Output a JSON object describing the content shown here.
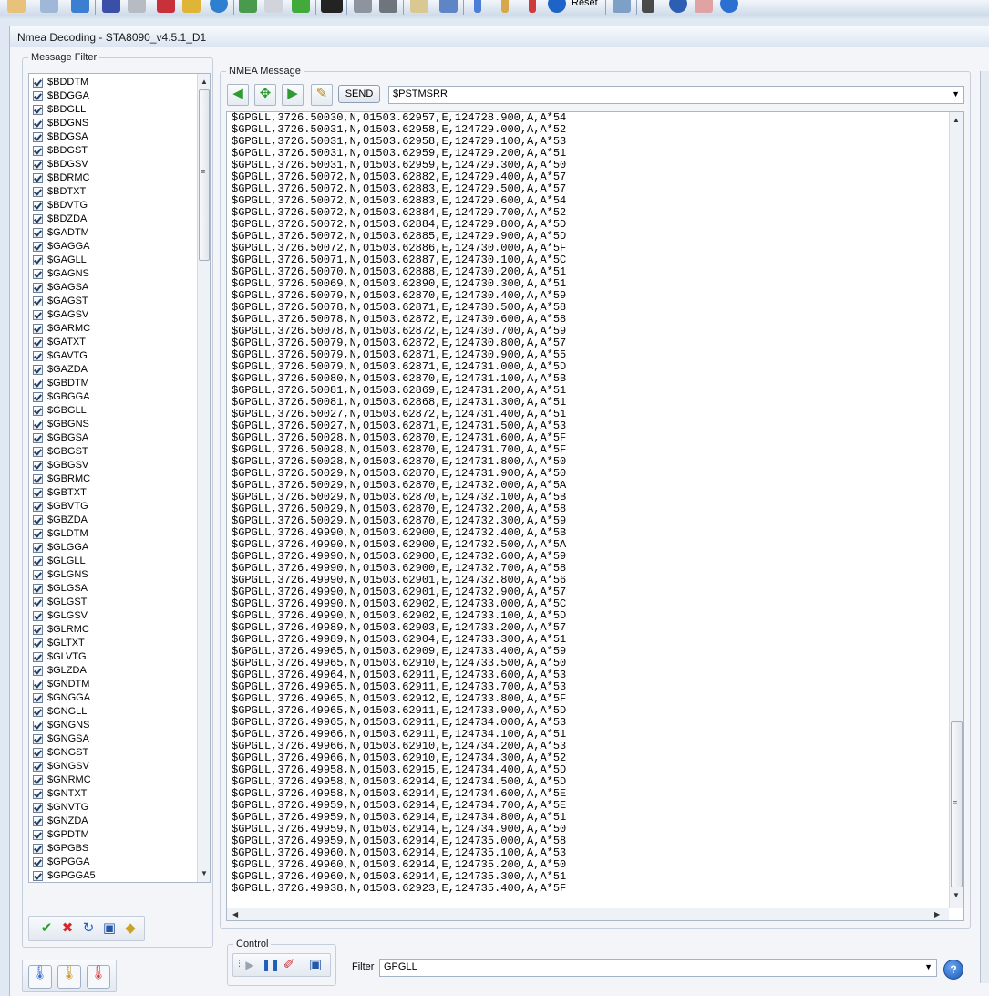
{
  "toolbar": {
    "reset_label": "Reset",
    "icons": [
      "edit-icon",
      "magnifier-icon",
      "settings-icon",
      "satellite-n-icon",
      "gear-icon",
      "antenna-icon",
      "chart-icon",
      "globe-icon",
      "signal-icon",
      "mouse-icon",
      "play-icon",
      "terminal-icon",
      "database-icon",
      "trash-icon",
      "map-icon",
      "document-icon",
      "thermometer-cold-icon",
      "thermometer-mid-icon",
      "thermometer-hot-icon",
      "reset-icon",
      "shield-icon",
      "tower-icon",
      "wave-icon",
      "graph-icon",
      "info-icon"
    ]
  },
  "window": {
    "title": "Nmea Decoding - STA8090_v4.5.1_D1"
  },
  "message_filter": {
    "legend": "Message Filter",
    "items": [
      "$BDDTM",
      "$BDGGA",
      "$BDGLL",
      "$BDGNS",
      "$BDGSA",
      "$BDGST",
      "$BDGSV",
      "$BDRMC",
      "$BDTXT",
      "$BDVTG",
      "$BDZDA",
      "$GADTM",
      "$GAGGA",
      "$GAGLL",
      "$GAGNS",
      "$GAGSA",
      "$GAGST",
      "$GAGSV",
      "$GARMC",
      "$GATXT",
      "$GAVTG",
      "$GAZDA",
      "$GBDTM",
      "$GBGGA",
      "$GBGLL",
      "$GBGNS",
      "$GBGSA",
      "$GBGST",
      "$GBGSV",
      "$GBRMC",
      "$GBTXT",
      "$GBVTG",
      "$GBZDA",
      "$GLDTM",
      "$GLGGA",
      "$GLGLL",
      "$GLGNS",
      "$GLGSA",
      "$GLGST",
      "$GLGSV",
      "$GLRMC",
      "$GLTXT",
      "$GLVTG",
      "$GLZDA",
      "$GNDTM",
      "$GNGGA",
      "$GNGLL",
      "$GNGNS",
      "$GNGSA",
      "$GNGST",
      "$GNGSV",
      "$GNRMC",
      "$GNTXT",
      "$GNVTG",
      "$GNZDA",
      "$GPDTM",
      "$GPGBS",
      "$GPGGA",
      "$GPGGA5"
    ]
  },
  "nmea_message": {
    "legend": "NMEA Message",
    "send_label": "SEND",
    "command_value": "$PSTMSRR",
    "lines": [
      "$GPGLL,3726.50030,N,01503.62957,E,124728.900,A,A*54",
      "$GPGLL,3726.50031,N,01503.62958,E,124729.000,A,A*52",
      "$GPGLL,3726.50031,N,01503.62958,E,124729.100,A,A*53",
      "$GPGLL,3726.50031,N,01503.62959,E,124729.200,A,A*51",
      "$GPGLL,3726.50031,N,01503.62959,E,124729.300,A,A*50",
      "$GPGLL,3726.50072,N,01503.62882,E,124729.400,A,A*57",
      "$GPGLL,3726.50072,N,01503.62883,E,124729.500,A,A*57",
      "$GPGLL,3726.50072,N,01503.62883,E,124729.600,A,A*54",
      "$GPGLL,3726.50072,N,01503.62884,E,124729.700,A,A*52",
      "$GPGLL,3726.50072,N,01503.62884,E,124729.800,A,A*5D",
      "$GPGLL,3726.50072,N,01503.62885,E,124729.900,A,A*5D",
      "$GPGLL,3726.50072,N,01503.62886,E,124730.000,A,A*5F",
      "$GPGLL,3726.50071,N,01503.62887,E,124730.100,A,A*5C",
      "$GPGLL,3726.50070,N,01503.62888,E,124730.200,A,A*51",
      "$GPGLL,3726.50069,N,01503.62890,E,124730.300,A,A*51",
      "$GPGLL,3726.50079,N,01503.62870,E,124730.400,A,A*59",
      "$GPGLL,3726.50078,N,01503.62871,E,124730.500,A,A*58",
      "$GPGLL,3726.50078,N,01503.62872,E,124730.600,A,A*58",
      "$GPGLL,3726.50078,N,01503.62872,E,124730.700,A,A*59",
      "$GPGLL,3726.50079,N,01503.62872,E,124730.800,A,A*57",
      "$GPGLL,3726.50079,N,01503.62871,E,124730.900,A,A*55",
      "$GPGLL,3726.50079,N,01503.62871,E,124731.000,A,A*5D",
      "$GPGLL,3726.50080,N,01503.62870,E,124731.100,A,A*5B",
      "$GPGLL,3726.50081,N,01503.62869,E,124731.200,A,A*51",
      "$GPGLL,3726.50081,N,01503.62868,E,124731.300,A,A*51",
      "$GPGLL,3726.50027,N,01503.62872,E,124731.400,A,A*51",
      "$GPGLL,3726.50027,N,01503.62871,E,124731.500,A,A*53",
      "$GPGLL,3726.50028,N,01503.62870,E,124731.600,A,A*5F",
      "$GPGLL,3726.50028,N,01503.62870,E,124731.700,A,A*5F",
      "$GPGLL,3726.50028,N,01503.62870,E,124731.800,A,A*50",
      "$GPGLL,3726.50029,N,01503.62870,E,124731.900,A,A*50",
      "$GPGLL,3726.50029,N,01503.62870,E,124732.000,A,A*5A",
      "$GPGLL,3726.50029,N,01503.62870,E,124732.100,A,A*5B",
      "$GPGLL,3726.50029,N,01503.62870,E,124732.200,A,A*58",
      "$GPGLL,3726.50029,N,01503.62870,E,124732.300,A,A*59",
      "$GPGLL,3726.49990,N,01503.62900,E,124732.400,A,A*5B",
      "$GPGLL,3726.49990,N,01503.62900,E,124732.500,A,A*5A",
      "$GPGLL,3726.49990,N,01503.62900,E,124732.600,A,A*59",
      "$GPGLL,3726.49990,N,01503.62900,E,124732.700,A,A*58",
      "$GPGLL,3726.49990,N,01503.62901,E,124732.800,A,A*56",
      "$GPGLL,3726.49990,N,01503.62901,E,124732.900,A,A*57",
      "$GPGLL,3726.49990,N,01503.62902,E,124733.000,A,A*5C",
      "$GPGLL,3726.49990,N,01503.62902,E,124733.100,A,A*5D",
      "$GPGLL,3726.49989,N,01503.62903,E,124733.200,A,A*57",
      "$GPGLL,3726.49989,N,01503.62904,E,124733.300,A,A*51",
      "$GPGLL,3726.49965,N,01503.62909,E,124733.400,A,A*59",
      "$GPGLL,3726.49965,N,01503.62910,E,124733.500,A,A*50",
      "$GPGLL,3726.49964,N,01503.62911,E,124733.600,A,A*53",
      "$GPGLL,3726.49965,N,01503.62911,E,124733.700,A,A*53",
      "$GPGLL,3726.49965,N,01503.62912,E,124733.800,A,A*5F",
      "$GPGLL,3726.49965,N,01503.62911,E,124733.900,A,A*5D",
      "$GPGLL,3726.49965,N,01503.62911,E,124734.000,A,A*53",
      "$GPGLL,3726.49966,N,01503.62911,E,124734.100,A,A*51",
      "$GPGLL,3726.49966,N,01503.62910,E,124734.200,A,A*53",
      "$GPGLL,3726.49966,N,01503.62910,E,124734.300,A,A*52",
      "$GPGLL,3726.49958,N,01503.62915,E,124734.400,A,A*5D",
      "$GPGLL,3726.49958,N,01503.62914,E,124734.500,A,A*5D",
      "$GPGLL,3726.49958,N,01503.62914,E,124734.600,A,A*5E",
      "$GPGLL,3726.49959,N,01503.62914,E,124734.700,A,A*5E",
      "$GPGLL,3726.49959,N,01503.62914,E,124734.800,A,A*51",
      "$GPGLL,3726.49959,N,01503.62914,E,124734.900,A,A*50",
      "$GPGLL,3726.49959,N,01503.62914,E,124735.000,A,A*58",
      "$GPGLL,3726.49960,N,01503.62914,E,124735.100,A,A*53",
      "$GPGLL,3726.49960,N,01503.62914,E,124735.200,A,A*50",
      "$GPGLL,3726.49960,N,01503.62914,E,124735.300,A,A*51",
      "$GPGLL,3726.49938,N,01503.62923,E,124735.400,A,A*5F"
    ]
  },
  "control": {
    "legend": "Control",
    "filter_label": "Filter",
    "filter_value": "GPGLL"
  },
  "help_glyph": "?"
}
